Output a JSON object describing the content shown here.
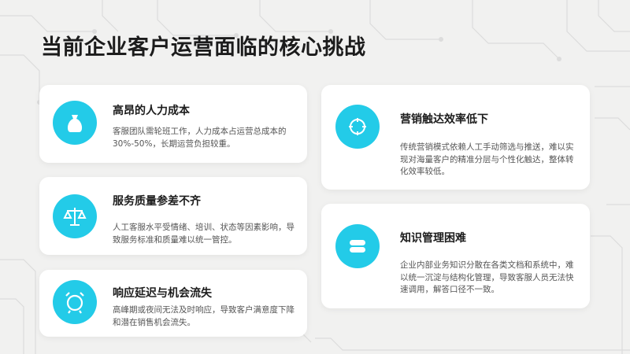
{
  "page": {
    "title": "当前企业客户运营面临的核心挑战"
  },
  "colors": {
    "accent": "#23cbe8",
    "background": "#f1f1f0",
    "card": "#ffffff"
  },
  "cards": [
    {
      "icon": "money-bag-icon",
      "title": "高昂的人力成本",
      "desc": "客服团队需轮班工作，人力成本占运营总成本的30%-50%，长期运营负担较重。"
    },
    {
      "icon": "scales-icon",
      "title": "服务质量参差不齐",
      "desc": "人工客服水平受情绪、培训、状态等因素影响，导致服务标准和质量难以统一管控。"
    },
    {
      "icon": "alarm-clock-icon",
      "title": "响应延迟与机会流失",
      "desc": "高峰期或夜间无法及时响应，导致客户满意度下降和潜在销售机会流失。"
    },
    {
      "icon": "target-crosshair-icon",
      "title": "营销触达效率低下",
      "desc": "传统营销模式依赖人工手动筛选与推送，难以实现对海量客户的精准分层与个性化触达，整体转化效率较低。"
    },
    {
      "icon": "database-stack-icon",
      "title": "知识管理困难",
      "desc": "企业内部业务知识分散在各类文档和系统中，难以统一沉淀与结构化管理，导致客服人员无法快速调用，解答口径不一致。"
    }
  ]
}
